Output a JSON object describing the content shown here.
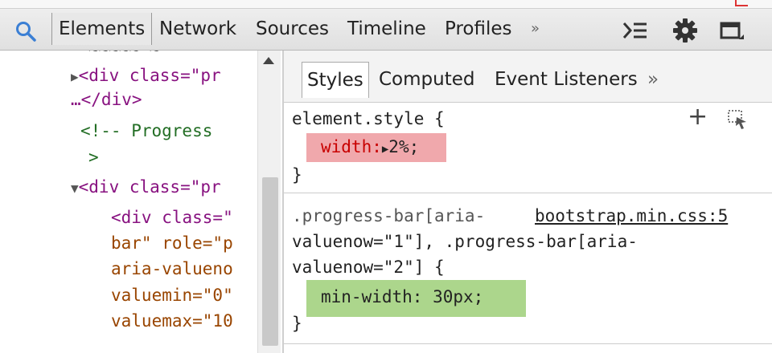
{
  "toolbar": {
    "tabs": [
      {
        "label": "Elements",
        "active": true
      },
      {
        "label": "Network",
        "active": false
      },
      {
        "label": "Sources",
        "active": false
      },
      {
        "label": "Timeline",
        "active": false
      },
      {
        "label": "Profiles",
        "active": false
      }
    ],
    "more_label": "»",
    "icons": [
      "search-icon",
      "console-drawer-icon",
      "gear-icon",
      "dock-icon"
    ]
  },
  "dom_tree": {
    "lines": [
      {
        "prefix": "▶",
        "text": "<div class=\"pr"
      },
      {
        "prefix": "",
        "text": "…</div>"
      },
      {
        "prefix": "",
        "text": "<!-- Progress"
      },
      {
        "prefix": "",
        "text": ">"
      },
      {
        "prefix": "▼",
        "text": "<div class=\"pr"
      },
      {
        "prefix": "",
        "text": "<div class=\""
      },
      {
        "prefix": "",
        "text": "bar\" role=\"p"
      },
      {
        "prefix": "",
        "text": "aria-valueno"
      },
      {
        "prefix": "",
        "text": "valuemin=\"0\""
      },
      {
        "prefix": "",
        "text": "valuemax=\"10"
      }
    ]
  },
  "styles_pane": {
    "tabs": [
      {
        "label": "Styles",
        "active": true
      },
      {
        "label": "Computed",
        "active": false
      },
      {
        "label": "Event Listeners",
        "active": false
      }
    ],
    "more_label": "»",
    "element_style": {
      "selector": "element.style {",
      "property": "width:",
      "arrow": "▶",
      "value": "2%;",
      "close": "}"
    },
    "rule2": {
      "selector_line1": ".progress-bar[aria-",
      "source": "bootstrap.min.css:5",
      "selector_line2": "valuenow=\"1\"], .progress-bar[aria-",
      "selector_line3": "valuenow=\"2\"] {",
      "declaration": "min-width: 30px;",
      "close": "}"
    },
    "add_label": "+"
  },
  "colors": {
    "tag": "#881280",
    "attr": "#994500",
    "comment": "#236e25",
    "highlight_pink": "#f0a8ac",
    "highlight_green": "#acd68c"
  }
}
